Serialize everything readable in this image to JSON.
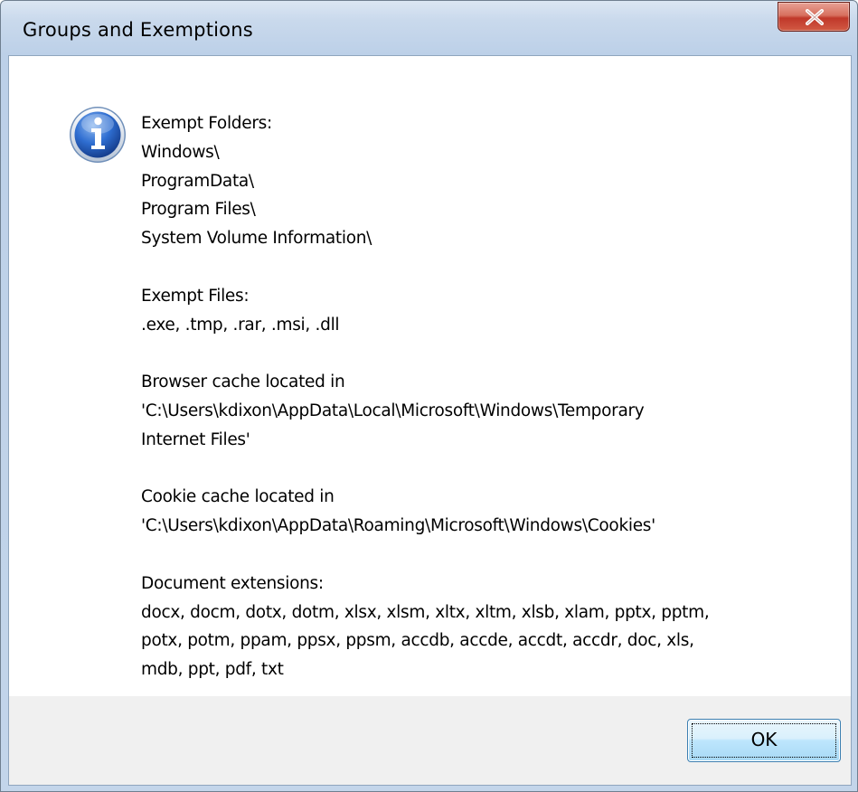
{
  "window": {
    "title": "Groups and Exemptions",
    "close_icon": "close-icon"
  },
  "dialog": {
    "icon": "information-icon",
    "lines": [
      "Exempt Folders:",
      "Windows\\",
      "ProgramData\\",
      "Program Files\\",
      "System Volume Information\\",
      "",
      "Exempt Files:",
      ".exe, .tmp, .rar, .msi, .dll",
      "",
      "Browser cache located in",
      "'C:\\Users\\kdixon\\AppData\\Local\\Microsoft\\Windows\\Temporary",
      "Internet Files'",
      "",
      "Cookie cache located in",
      "'C:\\Users\\kdixon\\AppData\\Roaming\\Microsoft\\Windows\\Cookies'",
      "",
      "Document extensions:",
      "docx, docm, dotx, dotm, xlsx, xlsm, xltx, xltm, xlsb, xlam, pptx, pptm,",
      "potx, potm, ppam, ppsx, ppsm, accdb, accde, accdt, accdr, doc, xls,",
      "mdb, ppt, pdf, txt"
    ]
  },
  "buttons": {
    "ok_label": "OK"
  },
  "colors": {
    "titlebar": "#c9d9ec",
    "close_button": "#c0382a",
    "footer": "#f0f0f0",
    "ok_border": "#3c7fb1"
  }
}
